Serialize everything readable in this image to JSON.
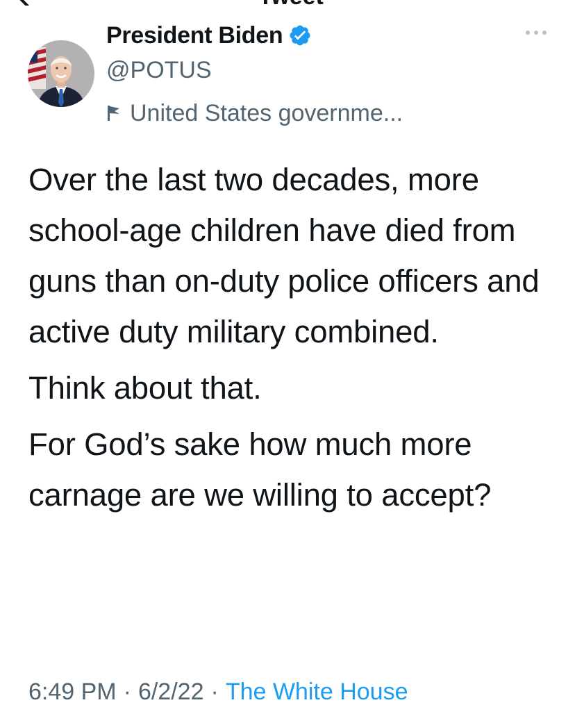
{
  "header": {
    "title": "Tweet"
  },
  "tweet": {
    "author": {
      "display_name": "President Biden",
      "handle": "@POTUS",
      "verified": true,
      "label": "United States governme..."
    },
    "body": {
      "paragraphs": [
        "Over the last two decades, more school-age children have died from guns than on-duty police officers and active duty military combined.",
        "Think about that.",
        "For God’s sake how much more carnage are we willing to accept?"
      ]
    },
    "meta": {
      "time": "6:49 PM",
      "separator": "·",
      "date": "6/2/22",
      "source": "The White House"
    }
  },
  "colors": {
    "text_primary": "#0f1419",
    "text_secondary": "#536471",
    "accent": "#1d9bf0"
  },
  "icons": {
    "verified": "verified-badge-icon",
    "more": "more-horizontal-icon",
    "label": "flag-icon",
    "back": "back-arrow-icon"
  }
}
